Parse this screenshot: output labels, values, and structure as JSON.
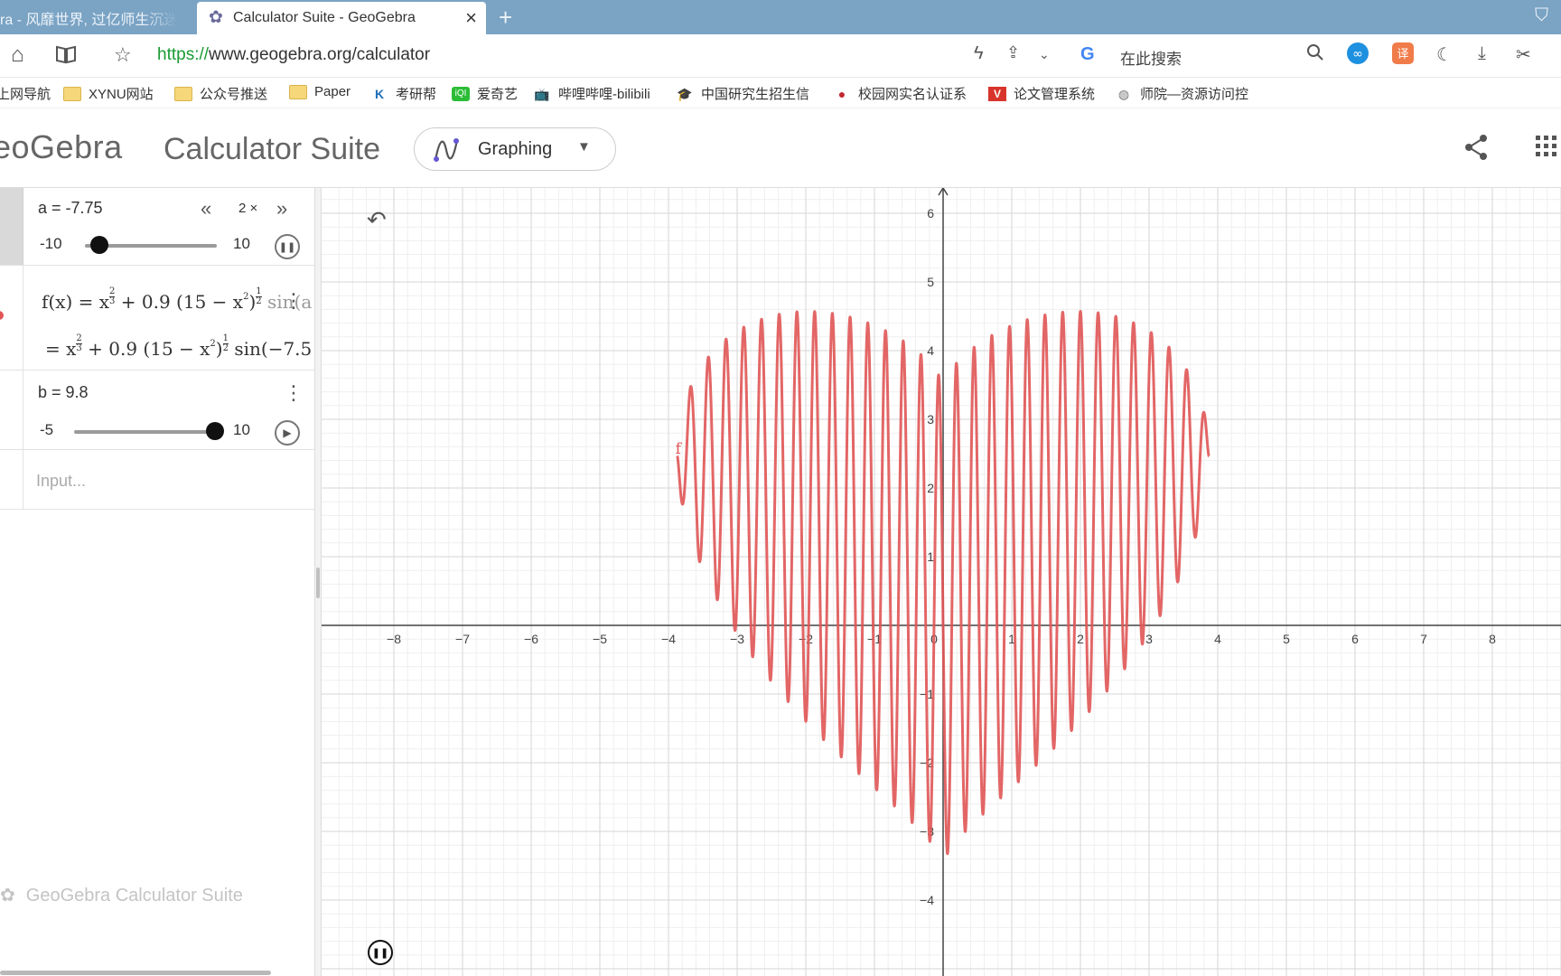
{
  "browser": {
    "tabs": [
      {
        "title": "ra - 风靡世界, 过亿师生沉迷",
        "active": false
      },
      {
        "title": "Calculator Suite - GeoGebra",
        "active": true
      }
    ],
    "url_scheme": "https://",
    "url_rest": "www.geogebra.org/calculator",
    "search_engine": "G",
    "search_placeholder": "在此搜索",
    "bookmarks": [
      {
        "label": "上网导航",
        "icon": "none"
      },
      {
        "label": "XYNU网站",
        "icon": "folder-icon"
      },
      {
        "label": "公众号推送",
        "icon": "folder-icon"
      },
      {
        "label": "Paper",
        "icon": "folder-icon"
      },
      {
        "label": "考研帮",
        "icon": "kaoyan-icon"
      },
      {
        "label": "爱奇艺",
        "icon": "iqiyi-icon"
      },
      {
        "label": "哔哩哔哩-bilibili",
        "icon": "bilibili-icon"
      },
      {
        "label": "中国研究生招生信",
        "icon": "graduation-cap-icon"
      },
      {
        "label": "校园网实名认证系",
        "icon": "campus-icon"
      },
      {
        "label": "论文管理系统",
        "icon": "v-icon"
      },
      {
        "label": "师院—资源访问控",
        "icon": "globe-icon"
      }
    ]
  },
  "app": {
    "logo": "eoGebra",
    "suite_title": "Calculator Suite",
    "app_picker_label": "Graphing",
    "accent": "#6557d2"
  },
  "algebra": {
    "slider_a": {
      "label": "a = -7.75",
      "min": "-10",
      "max": "10",
      "value": -7.75,
      "speed": "2 ×"
    },
    "function_line": "f(x) = x",
    "function_rest": " + 0.9 (15 − x",
    "function_tail": "sin(a",
    "function_value_line": "= x",
    "function_value_rest": " + 0.9 (15 − x",
    "function_value_tail": "sin(−7.5",
    "slider_b": {
      "label": "b = 9.8",
      "min": "-5",
      "max": "10",
      "value": 9.8
    },
    "input_placeholder": "Input...",
    "footer": "GeoGebra Calculator Suite"
  },
  "chart_data": {
    "type": "line",
    "title": "",
    "function": "f(x) = x^(2/3) + 0.9 (15 - x^2)^(1/2) sin(a π x), a = -7.75",
    "series": [
      {
        "name": "f",
        "color": "#e05555"
      }
    ],
    "x_domain": [
      -3.873,
      3.873
    ],
    "xlim": [
      -8.8,
      9.0
    ],
    "ylim": [
      -5.1,
      6.3
    ],
    "x_ticks": [
      -8,
      -7,
      -6,
      -5,
      -4,
      -3,
      -2,
      -1,
      0,
      1,
      2,
      3,
      4,
      5,
      6,
      7,
      8
    ],
    "y_ticks": [
      -4,
      -3,
      -2,
      -1,
      1,
      2,
      3,
      4,
      5,
      6
    ],
    "a": -7.75,
    "grid": true,
    "minor_grid": true
  }
}
